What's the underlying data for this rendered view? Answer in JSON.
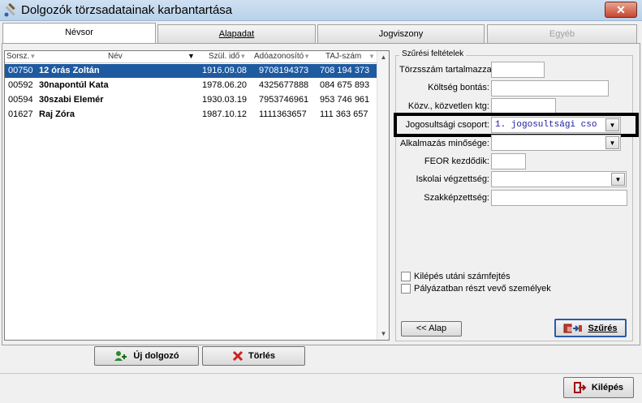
{
  "window": {
    "title": "Dolgozók törzsadatainak karbantartása",
    "close": "✕"
  },
  "tabs": [
    {
      "label": "Névsor"
    },
    {
      "label": "Alapadat"
    },
    {
      "label": "Jogviszony"
    },
    {
      "label": "Egyéb"
    }
  ],
  "grid": {
    "headers": [
      "Sorsz.",
      "Név",
      "Szül. idő",
      "Adóazonosító",
      "TAJ-szám"
    ],
    "rows": [
      {
        "sorsz": "00750",
        "nev": "12 órás Zoltán",
        "szul": "1916.09.08",
        "ado": "9708194373",
        "taj": "708 194 373",
        "selected": true
      },
      {
        "sorsz": "00592",
        "nev": "30napontúl Kata",
        "szul": "1978.06.20",
        "ado": "4325677888",
        "taj": "084 675 893",
        "selected": false
      },
      {
        "sorsz": "00594",
        "nev": "30szabi Elemér",
        "szul": "1930.03.19",
        "ado": "7953746961",
        "taj": "953 746 961",
        "selected": false
      },
      {
        "sorsz": "01627",
        "nev": "Raj Zóra",
        "szul": "1987.10.12",
        "ado": "1111363657",
        "taj": "111 363 657",
        "selected": false
      }
    ]
  },
  "filters": {
    "title": "Szűrési feltételek",
    "torzsszam_label": "Törzsszám tartalmazza:",
    "torzsszam_value": "",
    "koltseg_label": "Költség bontás:",
    "koltseg_value": "",
    "kozv_label": "Közv., közvetlen ktg:",
    "kozv_value": "",
    "jogosultsagi_label": "Jogosultsági csoport:",
    "jogosultsagi_value": "1. jogosultsági cso",
    "alkalmazas_label": "Alkalmazás minősége:",
    "alkalmazas_value": "",
    "feor_label": "FEOR kezdődik:",
    "feor_value": "",
    "iskolai_label": "Iskolai végzettség:",
    "iskolai_value": "",
    "szakkepz_label": "Szakképzettség:",
    "szakkepz_value": "",
    "check1_label": "Kilépés utáni számfejtés",
    "check2_label": "Pályázatban részt vevő személyek",
    "alap_button": "<< Alap",
    "szures_button": "Szűrés"
  },
  "buttons": {
    "uj_dolgozo": "Új dolgozó",
    "torles": "Törlés",
    "kilepes": "Kilépés"
  },
  "colors": {
    "selection": "#1e5aa0",
    "mono_text": "#1a1aa0"
  }
}
